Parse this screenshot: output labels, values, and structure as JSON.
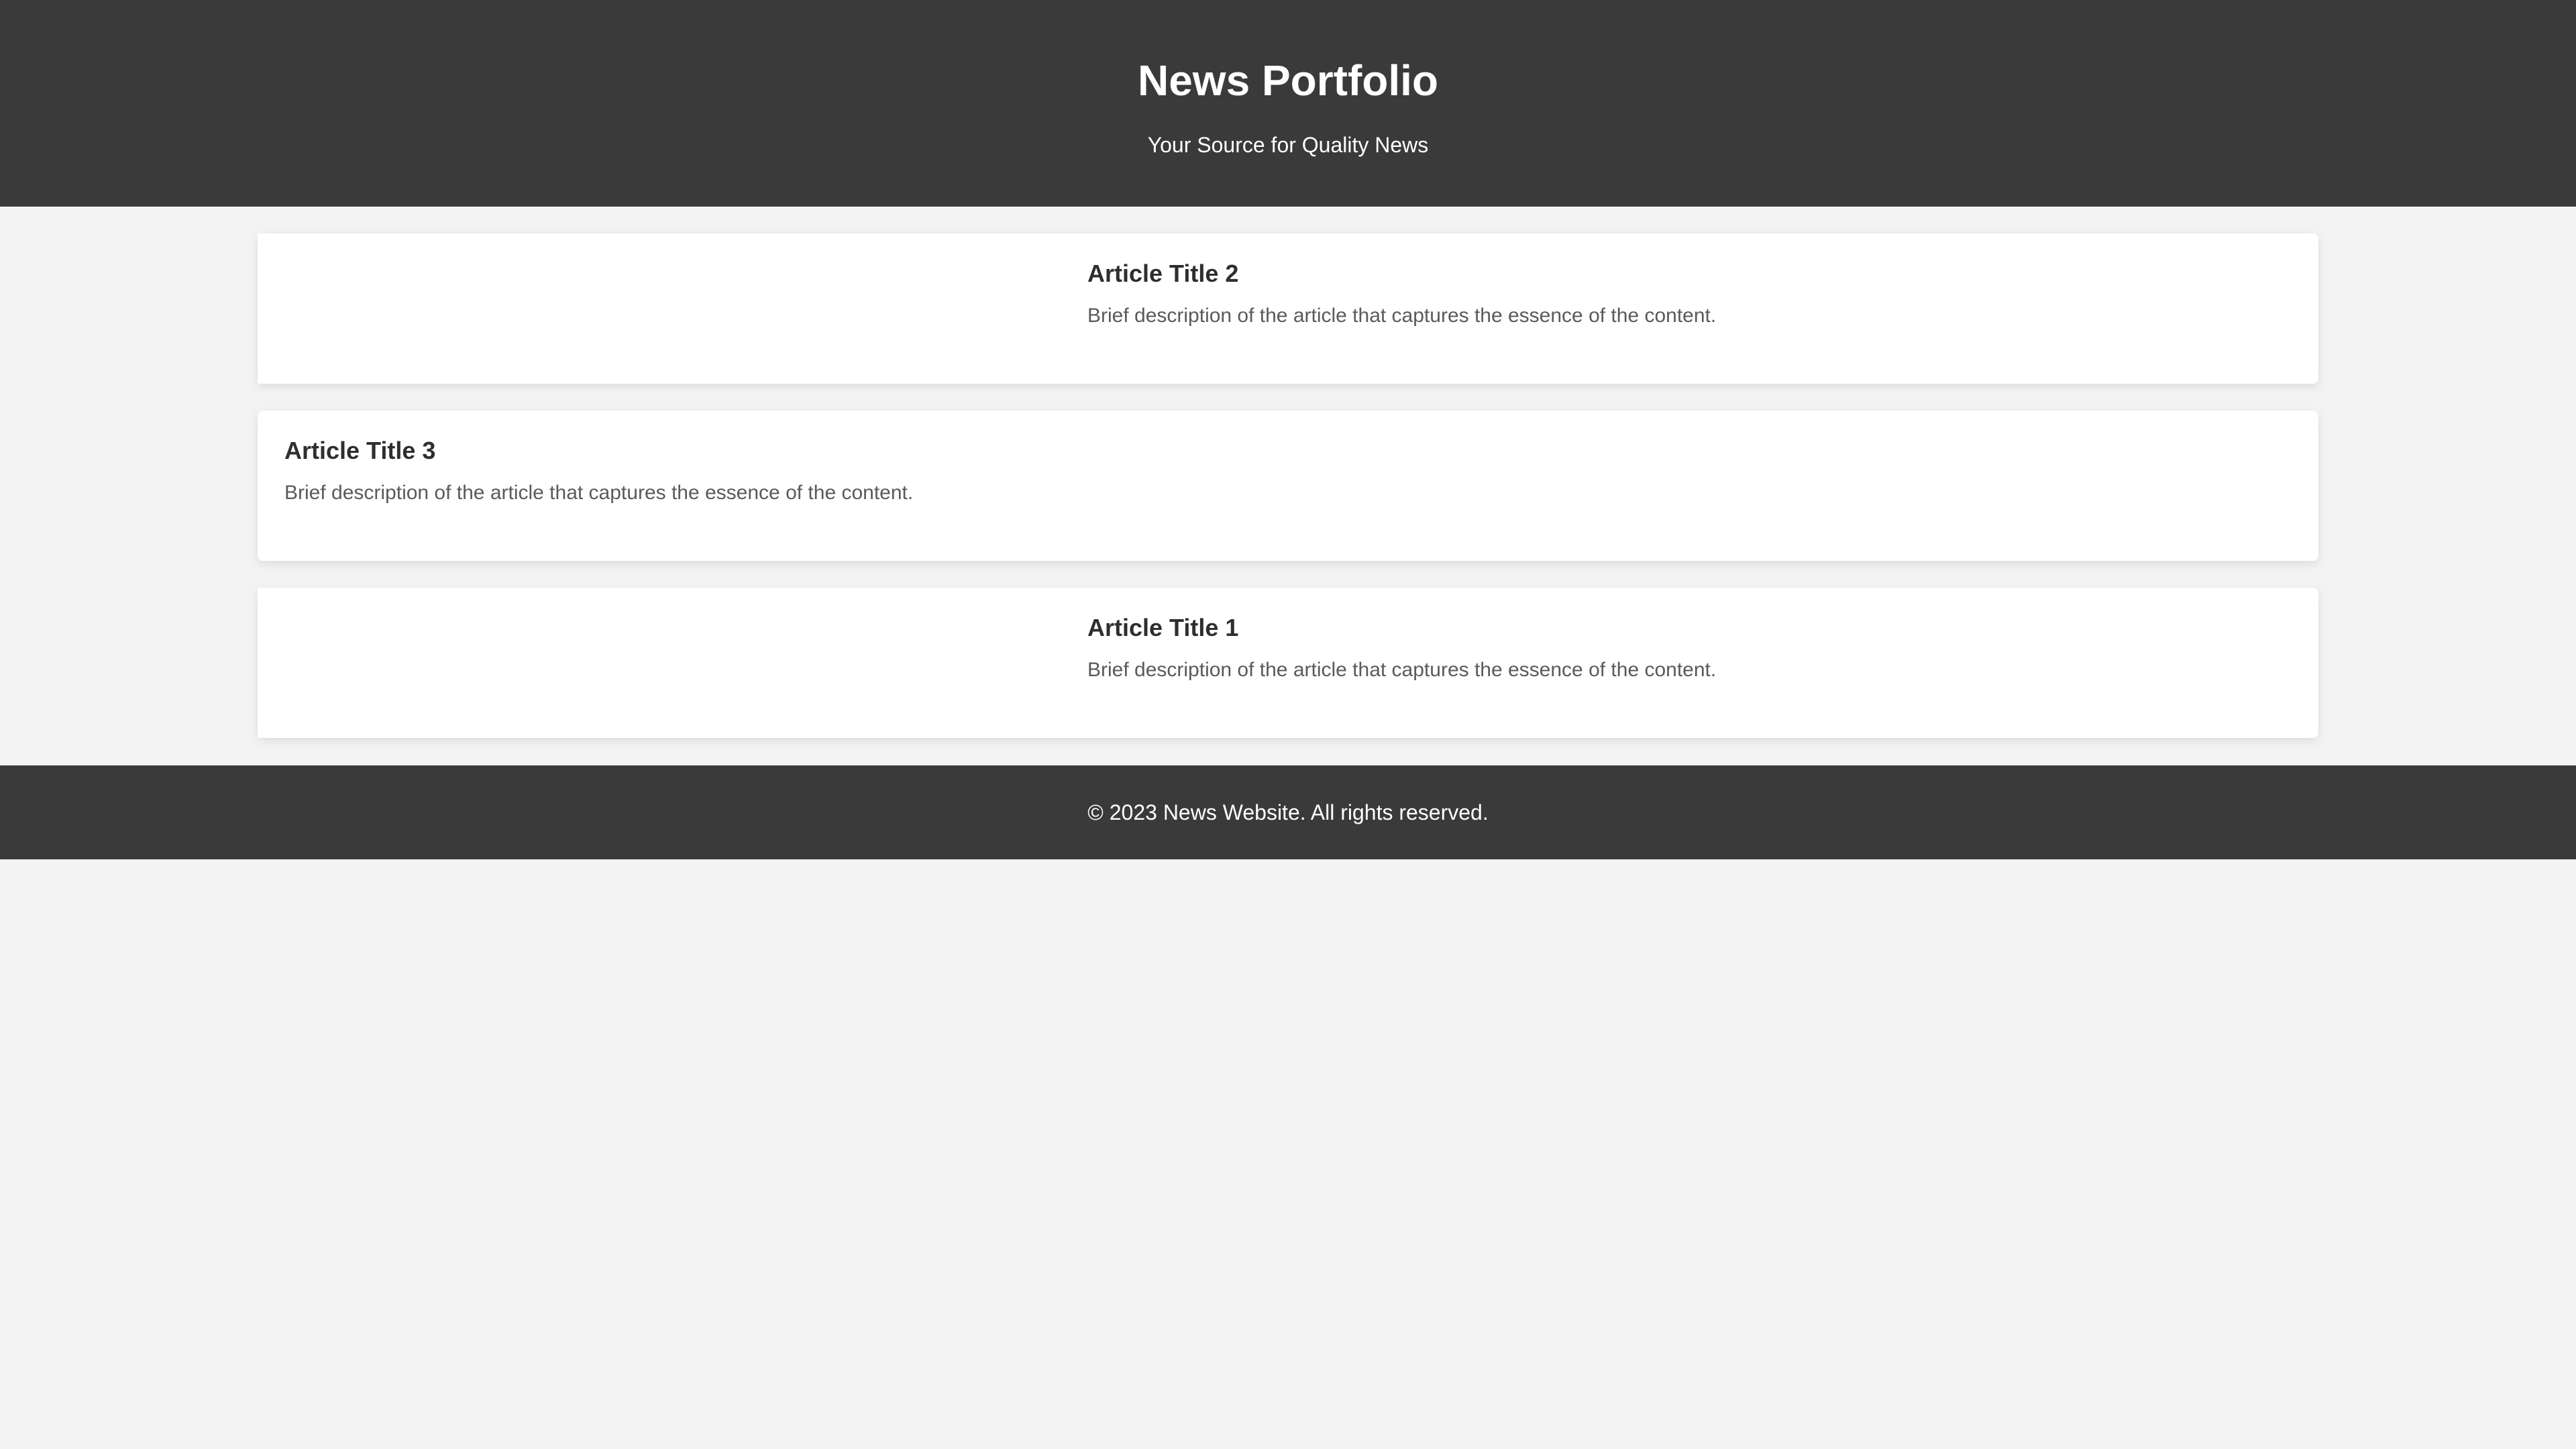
{
  "header": {
    "title": "News Portfolio",
    "tagline": "Your Source for Quality News"
  },
  "articles": [
    {
      "title": "Article Title 2",
      "description": "Brief description of the article that captures the essence of the content."
    },
    {
      "title": "Article Title 3",
      "description": "Brief description of the article that captures the essence of the content."
    },
    {
      "title": "Article Title 1",
      "description": "Brief description of the article that captures the essence of the content."
    }
  ],
  "footer": {
    "text": "© 2023 News Website. All rights reserved."
  },
  "colors": {
    "header_bg": "#3a3a3a",
    "page_bg": "#f3f3f3",
    "card_bg": "#ffffff",
    "title_text": "#2e2e2e",
    "description_text": "#5a5a5a"
  }
}
